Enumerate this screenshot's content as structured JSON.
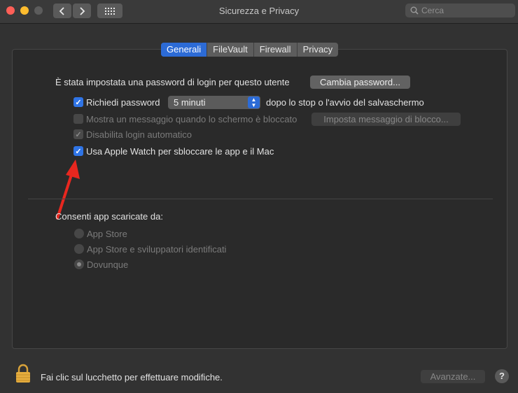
{
  "window": {
    "title": "Sicurezza e Privacy",
    "search_placeholder": "Cerca"
  },
  "toolbar": {
    "back_icon": "chevron-left-icon",
    "forward_icon": "chevron-right-icon",
    "grid_icon": "grid-icon"
  },
  "tabs": [
    {
      "label": "Generali",
      "active": true
    },
    {
      "label": "FileVault",
      "active": false
    },
    {
      "label": "Firewall",
      "active": false
    },
    {
      "label": "Privacy",
      "active": false
    }
  ],
  "general": {
    "login_password_text": "È stata impostata una password di login per questo utente",
    "change_password_button": "Cambia password...",
    "require_password": {
      "label": "Richiedi password",
      "checked": true
    },
    "require_password_delay": "5 minuti",
    "require_password_suffix": "dopo lo stop o l'avvio del salvaschermo",
    "show_message": {
      "label": "Mostra un messaggio quando lo schermo è bloccato",
      "checked": false,
      "enabled": false
    },
    "set_lock_message_button": "Imposta messaggio di blocco...",
    "disable_auto_login": {
      "label": "Disabilita login automatico",
      "checked": true,
      "enabled": false
    },
    "apple_watch_unlock": {
      "label": "Usa Apple Watch per sbloccare le app e il Mac",
      "checked": true
    }
  },
  "downloads": {
    "heading": "Consenti app scaricate da:",
    "options": [
      {
        "label": "App Store",
        "selected": false
      },
      {
        "label": "App Store e sviluppatori identificati",
        "selected": false
      },
      {
        "label": "Dovunque",
        "selected": true
      }
    ]
  },
  "footer": {
    "lock_text": "Fai clic sul lucchetto per effettuare modifiche.",
    "advanced_button": "Avanzate...",
    "help_label": "?"
  },
  "colors": {
    "accent": "#2c6bd6",
    "annotation_arrow": "#e8271f"
  }
}
